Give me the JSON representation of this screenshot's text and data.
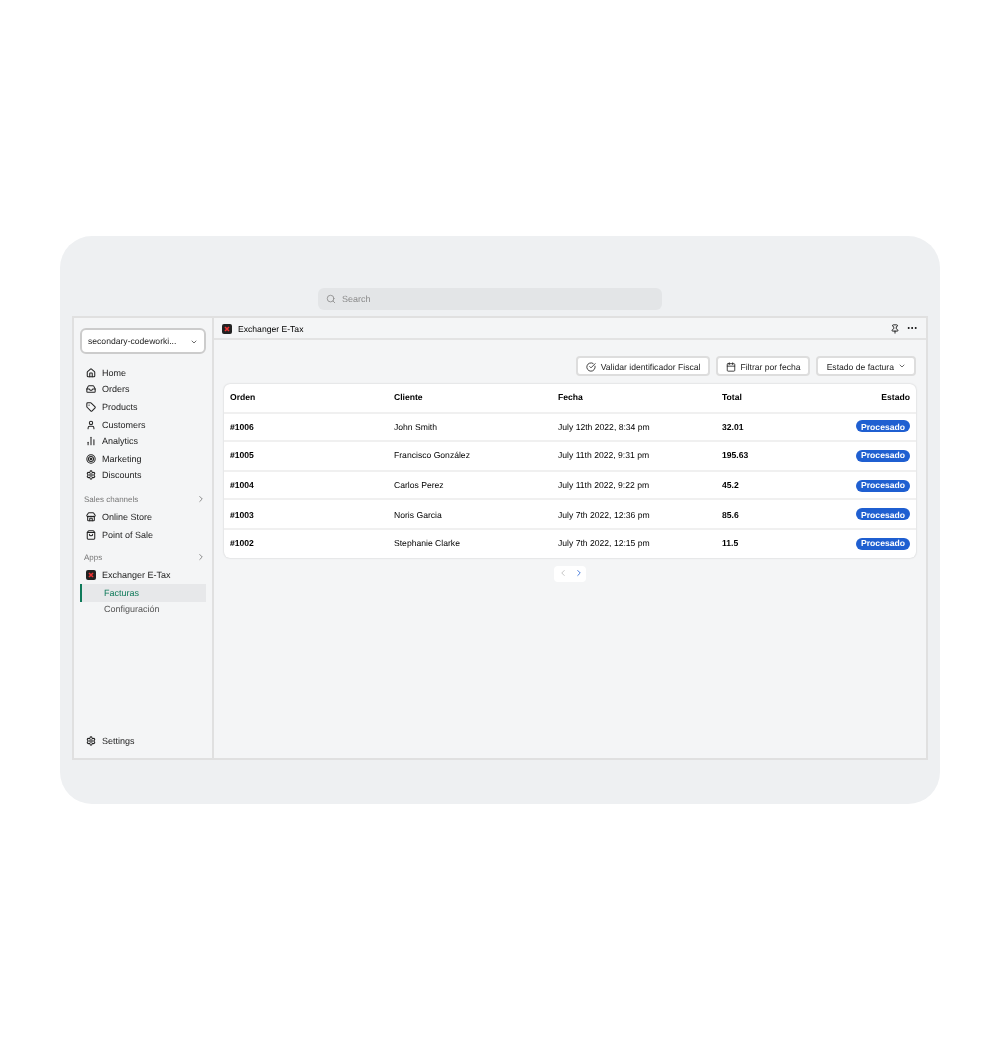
{
  "search": {
    "placeholder": "Search"
  },
  "store_selector": {
    "value": "secondary-codeworki..."
  },
  "nav": [
    {
      "label": "Home",
      "selected": false
    },
    {
      "label": "Orders",
      "selected": false
    },
    {
      "label": "Products",
      "selected": false
    },
    {
      "label": "Customers",
      "selected": false
    },
    {
      "label": "Analytics",
      "selected": false
    },
    {
      "label": "Marketing",
      "selected": false
    },
    {
      "label": "Discounts",
      "selected": false
    }
  ],
  "sales_channels": {
    "title": "Sales channels",
    "items": [
      {
        "label": "Online Store",
        "selected": false
      },
      {
        "label": "Point of Sale",
        "selected": false
      }
    ]
  },
  "apps": {
    "title": "Apps",
    "app": {
      "label": "Exchanger E-Tax"
    },
    "items": [
      {
        "label": "Facturas",
        "selected": true
      },
      {
        "label": "Configuración",
        "selected": false
      }
    ]
  },
  "settings": {
    "label": "Settings"
  },
  "header": {
    "title": "Exchanger E-Tax"
  },
  "actions": [
    {
      "label": "Validar identificador Fiscal",
      "kind": "validate"
    },
    {
      "label": "Filtrar por fecha",
      "kind": "date"
    },
    {
      "label": "Estado de factura",
      "kind": "dropdown"
    }
  ],
  "table": {
    "columns": [
      "Orden",
      "Cliente",
      "Fecha",
      "Total",
      "Estado"
    ],
    "rows": [
      {
        "order": "#1006",
        "client": "John Smith",
        "date": "July 12th 2022, 8:34 pm",
        "total": "32.01",
        "status": "Procesado"
      },
      {
        "order": "#1005",
        "client": "Francisco González",
        "date": "July 11th 2022, 9:31 pm",
        "total": "195.63",
        "status": "Procesado"
      },
      {
        "order": "#1004",
        "client": "Carlos Perez",
        "date": "July 11th 2022, 9:22 pm",
        "total": "45.2",
        "status": "Procesado"
      },
      {
        "order": "#1003",
        "client": "Noris Garcia",
        "date": "July 7th 2022, 12:36 pm",
        "total": "85.6",
        "status": "Procesado"
      },
      {
        "order": "#1002",
        "client": "Stephanie Clarke",
        "date": "July 7th 2022, 12:15 pm",
        "total": "11.5",
        "status": "Procesado"
      }
    ]
  },
  "pagination": {
    "previous_disabled": true,
    "next_disabled": false
  }
}
